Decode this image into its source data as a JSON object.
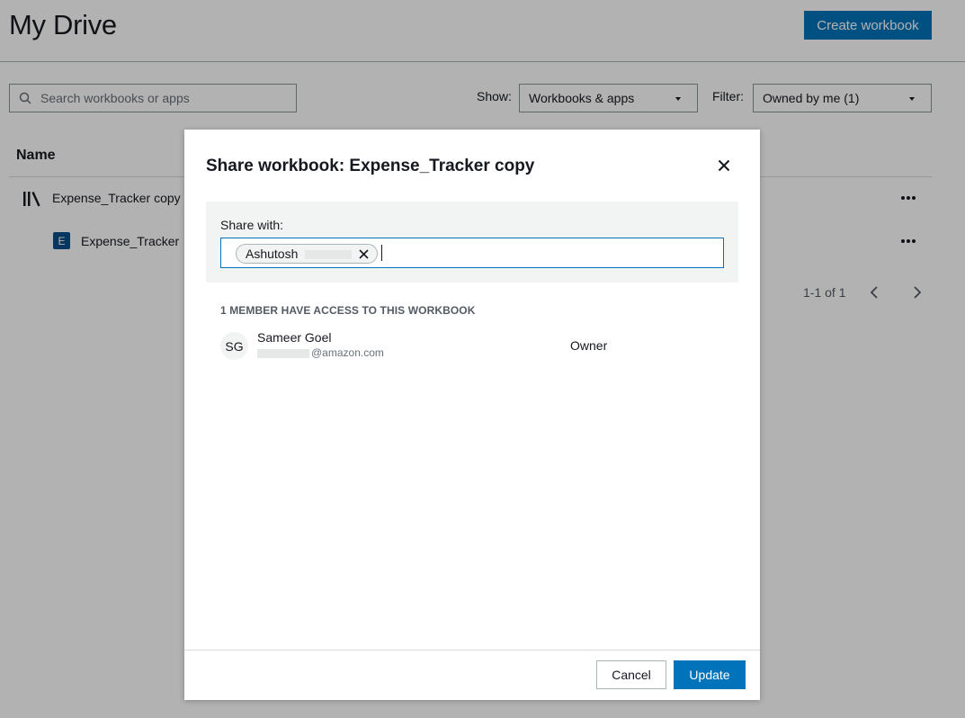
{
  "header": {
    "title": "My Drive",
    "create_button": "Create workbook"
  },
  "toolbar": {
    "search_placeholder": "Search workbooks or apps",
    "show_label": "Show:",
    "show_value": "Workbooks & apps",
    "filter_label": "Filter:",
    "filter_value": "Owned by me (1)"
  },
  "table": {
    "name_header": "Name",
    "rows": [
      {
        "name": "Expense_Tracker copy",
        "icon": "library-icon"
      },
      {
        "name": "Expense_Tracker",
        "icon": "workbook-e-icon",
        "badge": "E"
      }
    ],
    "pagination": "1-1 of 1"
  },
  "modal": {
    "title": "Share workbook: Expense_Tracker copy",
    "share_label": "Share with:",
    "token_name": "Ashutosh",
    "members_heading": "1 MEMBER HAVE ACCESS TO THIS WORKBOOK",
    "members": [
      {
        "initials": "SG",
        "name": "Sameer Goel",
        "email_suffix": "@amazon.com",
        "role": "Owner"
      }
    ],
    "cancel_label": "Cancel",
    "update_label": "Update"
  },
  "colors": {
    "primary": "#0073bb",
    "overlay": "rgba(0,0,0,0.30)"
  }
}
